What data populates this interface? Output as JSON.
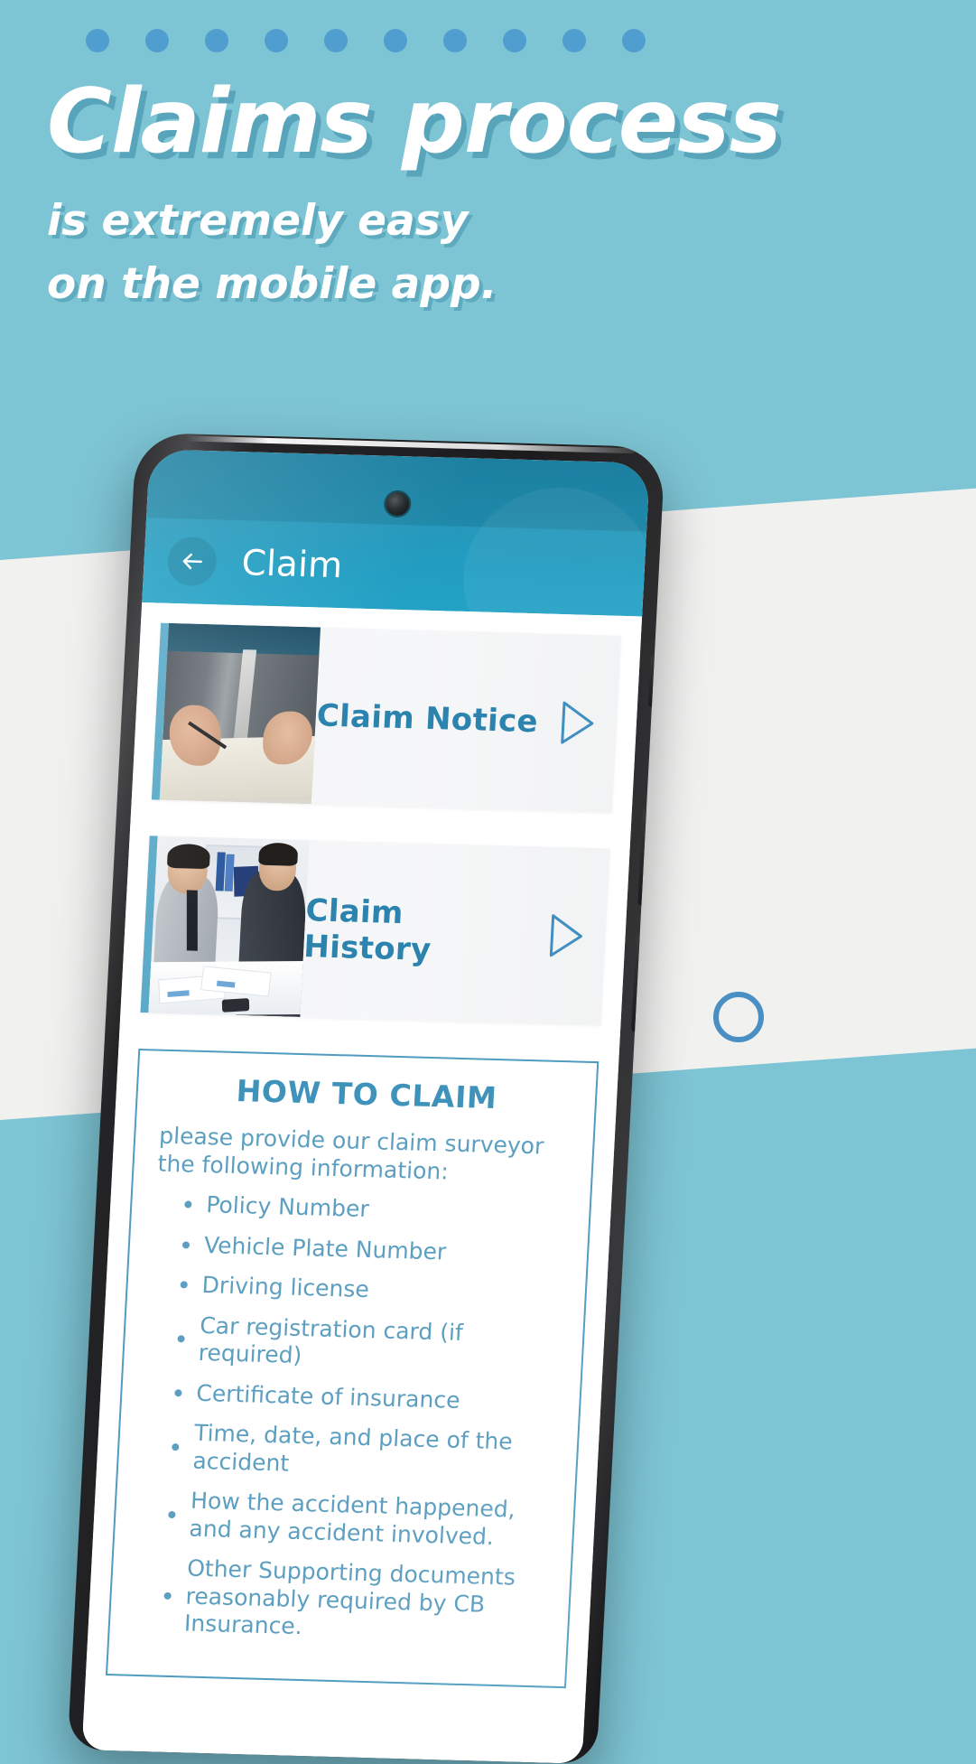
{
  "poster": {
    "headline": "Claims process",
    "subline_1": "is extremely easy",
    "subline_2": "on the mobile app.",
    "dot_count": 10,
    "colors": {
      "background": "#7dc4d4",
      "band": "#f1f1f0",
      "dot": "#4e9cd0",
      "ring": "#4a8fc4",
      "headline_text": "#ffffff"
    }
  },
  "phone": {
    "app": {
      "appbar": {
        "back_icon": "arrow-left-icon",
        "title": "Claim",
        "background_color": "#229ec2"
      },
      "cards": [
        {
          "title": "Claim Notice",
          "thumbnail": "person-signing-document-photo",
          "play_icon": "play-triangle-icon"
        },
        {
          "title": "Claim History",
          "thumbnail": "two-businessmen-meeting-photo",
          "play_icon": "play-triangle-icon"
        }
      ],
      "how_to_claim": {
        "title": "HOW TO CLAIM",
        "intro": "please provide our claim surveyor the following information:",
        "items": [
          "Policy Number",
          "Vehicle Plate Number",
          "Driving license",
          "Car registration card (if required)",
          "Certificate of insurance",
          "Time, date, and place of the accident",
          "How the accident happened, and any accident involved.",
          "Other Supporting documents reasonably required by CB Insurance."
        ],
        "border_color": "#4f9cc0",
        "text_color": "#5d9fc0"
      }
    }
  }
}
